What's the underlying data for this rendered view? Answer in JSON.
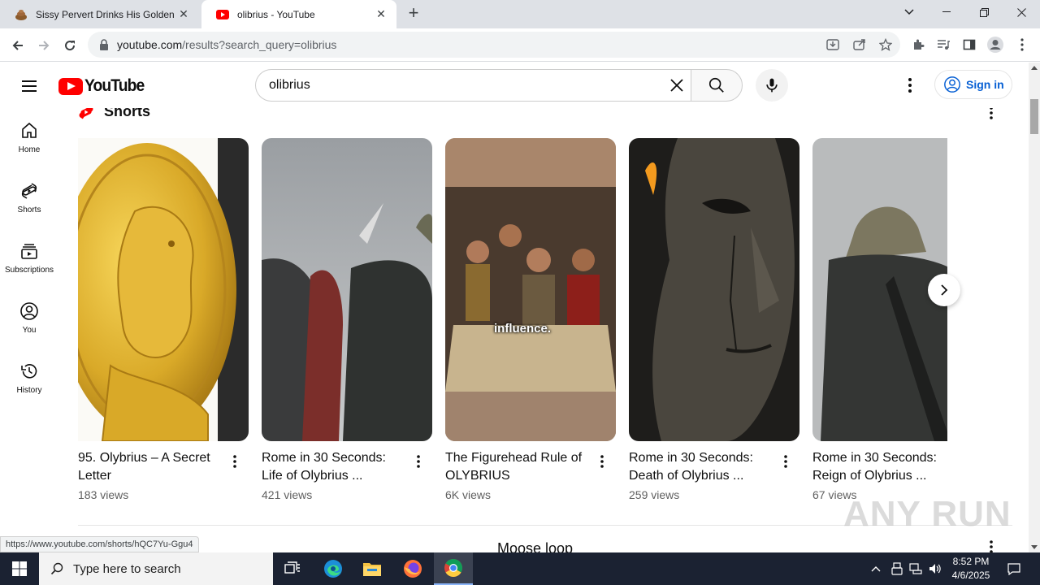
{
  "browser": {
    "tabs": [
      {
        "title": "Sissy Pervert Drinks His Golden p",
        "active": false
      },
      {
        "title": "olibrius - YouTube",
        "active": true
      }
    ],
    "address": {
      "host": "youtube.com",
      "path": "/results?search_query=olibrius"
    },
    "status_url": "https://www.youtube.com/shorts/hQC7Yu-Ggu4"
  },
  "youtube": {
    "logo_text": "YouTube",
    "search_query": "olibrius",
    "sign_in": "Sign in",
    "guide": [
      {
        "label": "Home",
        "icon": "home-icon"
      },
      {
        "label": "Shorts",
        "icon": "shorts-icon"
      },
      {
        "label": "Subscriptions",
        "icon": "subscriptions-icon"
      },
      {
        "label": "You",
        "icon": "you-icon"
      },
      {
        "label": "History",
        "icon": "history-icon"
      }
    ],
    "shelf_title": "Shorts",
    "shorts": [
      {
        "title": "95. Olybrius – A Secret Letter",
        "views": "183 views"
      },
      {
        "title": "Rome in 30 Seconds: Life of Olybrius ...",
        "views": "421 views"
      },
      {
        "title": "The Figurehead Rule of OLYBRIUS",
        "views": "6K views",
        "overlay": "influence."
      },
      {
        "title": "Rome in 30 Seconds: Death of Olybrius ...",
        "views": "259 views"
      },
      {
        "title": "Rome in 30 Seconds: Reign of Olybrius ...",
        "views": "67 views"
      }
    ],
    "next_section_title": "Moose loop"
  },
  "watermark": "ANY RUN",
  "taskbar": {
    "search_placeholder": "Type here to search",
    "time": "8:52 PM",
    "date": "4/6/2025"
  },
  "colors": {
    "youtube_red": "#ff0000",
    "link_blue": "#065fd4",
    "taskbar": "#1b2232"
  }
}
